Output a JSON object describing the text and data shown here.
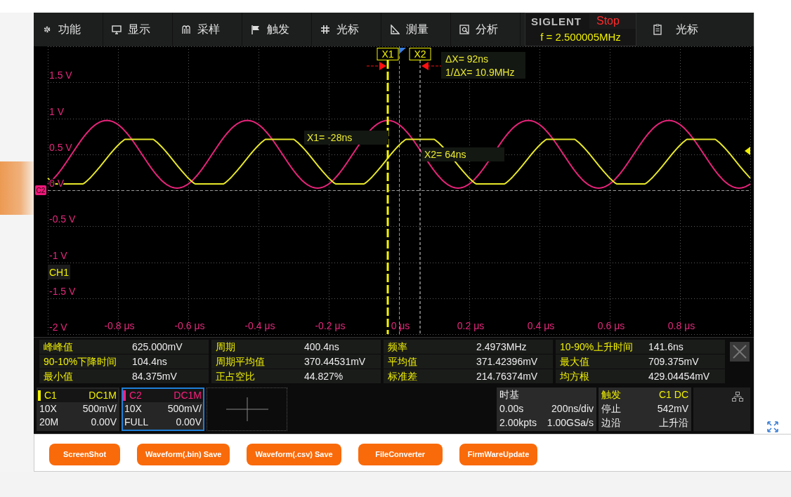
{
  "side_tab": {
    "kind": "tab"
  },
  "menu": [
    {
      "label": "功能"
    },
    {
      "label": "显示"
    },
    {
      "label": "采样"
    },
    {
      "label": "触发"
    },
    {
      "label": "光标"
    },
    {
      "label": "测量"
    },
    {
      "label": "分析"
    }
  ],
  "brand": {
    "logo": "SIGLENT",
    "status": "Stop",
    "frequency": "f = 2.500005MHz"
  },
  "menu_right": {
    "label": "光标"
  },
  "plot": {
    "y_labels": [
      "1.5 V",
      "1 V",
      "0.5 V",
      "0 V",
      "-0.5 V",
      "-1 V",
      "-1.5 V",
      "-2 V"
    ],
    "x_labels": [
      "-0.8 μs",
      "-0.6 μs",
      "-0.4 μs",
      "-0.2 μs",
      "0 μs",
      "0.2 μs",
      "0.4 μs",
      "0.6 μs",
      "0.8 μs"
    ],
    "channel_tag": "C2",
    "channel_label": "CH1",
    "cursors": [
      {
        "label": "X1",
        "readout": "X1= -28ns"
      },
      {
        "label": "X2",
        "readout": "X2= 64ns"
      }
    ],
    "delta": [
      "ΔX= 92ns",
      "1/ΔX= 10.9MHz"
    ]
  },
  "measurements": [
    {
      "label": "峰峰值",
      "value": "625.000mV"
    },
    {
      "label": "周期",
      "value": "400.4ns"
    },
    {
      "label": "频率",
      "value": "2.4973MHz"
    },
    {
      "label": "10-90%上升时间",
      "value": "141.6ns"
    },
    {
      "label": "90-10%下降时间",
      "value": "104.4ns"
    },
    {
      "label": "周期平均值",
      "value": "370.44531mV"
    },
    {
      "label": "平均值",
      "value": "371.42396mV"
    },
    {
      "label": "最大值",
      "value": "709.375mV"
    },
    {
      "label": "最小值",
      "value": "84.375mV"
    },
    {
      "label": "正占空比",
      "value": "44.827%"
    },
    {
      "label": "标准差",
      "value": "214.76374mV"
    },
    {
      "label": "均方根",
      "value": "429.04454mV"
    }
  ],
  "channels": [
    {
      "name": "C1",
      "coupling": "DC1M",
      "probe": "10X",
      "scale": "500mV/",
      "bandwidth": "20M",
      "offset": "0.00V",
      "selected": false,
      "color": "#f0f000"
    },
    {
      "name": "C2",
      "coupling": "DC1M",
      "probe": "10X",
      "scale": "500mV/",
      "bandwidth": "FULL",
      "offset": "0.00V",
      "selected": true,
      "color": "#ff1f7e"
    }
  ],
  "timebase": {
    "title": "时基",
    "delay": "0.00s",
    "scale": "200ns/div",
    "depth": "2.00kpts",
    "rate": "1.00GSa/s"
  },
  "trigger": {
    "title": "触发",
    "source": "C1 DC",
    "mode": "停止",
    "level": "542mV",
    "type": "边沿",
    "slope": "上升沿"
  },
  "buttons": [
    "ScreenShot",
    "Waveform(.bin) Save",
    "Waveform(.csv) Save",
    "FileConverter",
    "FirmWareUpdate"
  ]
}
